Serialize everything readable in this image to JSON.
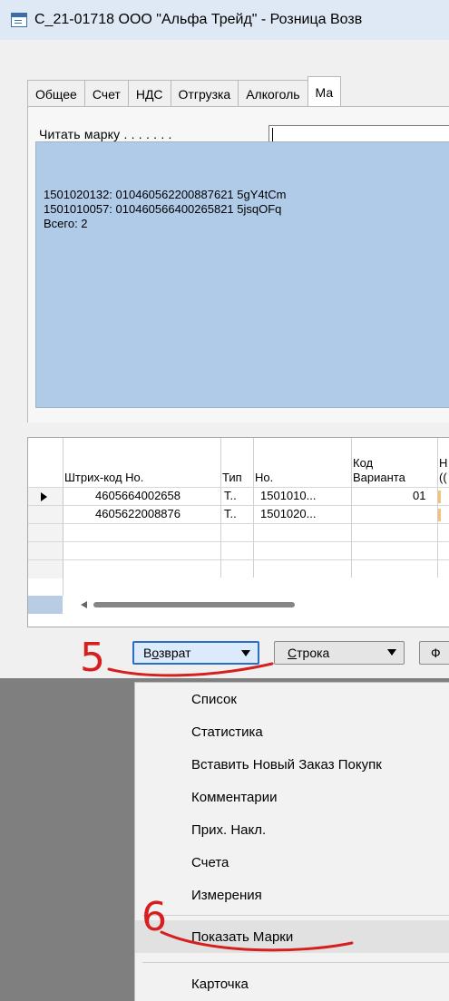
{
  "window": {
    "title": "С_21-01718 ООО \"Альфа Трейд\" - Розница Возв"
  },
  "tabs": [
    {
      "label": "Общее",
      "active": false
    },
    {
      "label": "Счет",
      "active": false
    },
    {
      "label": "НДС",
      "active": false
    },
    {
      "label": "Отгрузка",
      "active": false
    },
    {
      "label": "Алкоголь",
      "active": false
    },
    {
      "label": "Ма",
      "active": true
    }
  ],
  "marks_tab": {
    "read_label": "Читать марку . . . . . . .",
    "read_value": "",
    "lines": [
      "1501020132: 010460562200887621 5gY4tCm",
      "1501010057: 010460566400265821 5jsqOFq",
      "Всего: 2"
    ]
  },
  "grid": {
    "headers": {
      "barcode": "Штрих-код Но.",
      "type": "Тип",
      "no": "Но.",
      "variant_line1": "Код",
      "variant_line2": "Варианта",
      "extra_line1": "Н",
      "extra_line2": "(("
    },
    "rows": [
      {
        "barcode": "4605664002658",
        "type": "Т..",
        "no": "1501010...",
        "variant": "01",
        "current": true
      },
      {
        "barcode": "4605622008876",
        "type": "Т..",
        "no": "1501020...",
        "variant": "",
        "current": false
      },
      {
        "barcode": "",
        "type": "",
        "no": "",
        "variant": "",
        "current": false
      },
      {
        "barcode": "",
        "type": "",
        "no": "",
        "variant": "",
        "current": false
      },
      {
        "barcode": "",
        "type": "",
        "no": "",
        "variant": "",
        "current": false
      }
    ]
  },
  "buttons": {
    "return_pre": "В",
    "return_ul": "о",
    "return_post": "зврат",
    "line_ul": "С",
    "line_post": "трока",
    "func": "Ф"
  },
  "menu": {
    "items": [
      "Список",
      "Статистика",
      "Вставить Новый Заказ Покупк",
      "Комментарии",
      "Прих. Накл.",
      "Счета",
      "Измерения",
      "Показать Марки",
      "Карточка"
    ]
  },
  "annotations": {
    "step5": "5",
    "step6": "6",
    "color": "#d61f1f"
  },
  "colors": {
    "selection_box": "#afcbe8",
    "primary_button_border": "#2b6fc4"
  }
}
